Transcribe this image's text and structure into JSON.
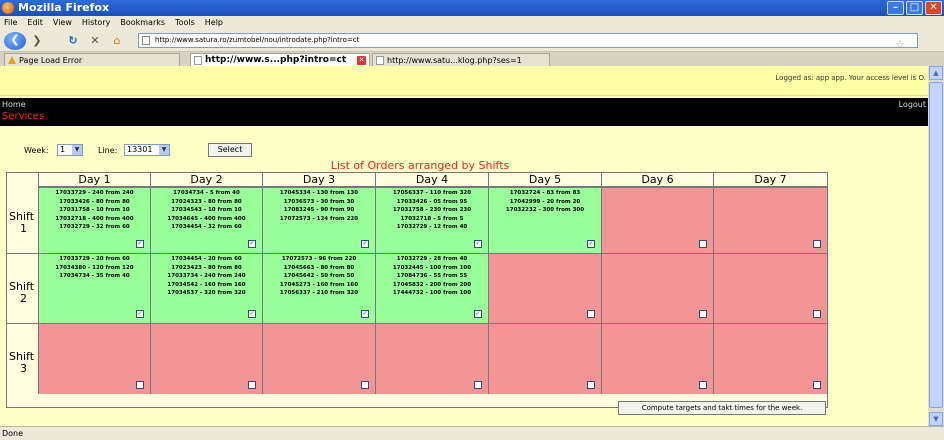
{
  "window": {
    "title": "Mozilla Firefox"
  },
  "menu": [
    "File",
    "Edit",
    "View",
    "History",
    "Bookmarks",
    "Tools",
    "Help"
  ],
  "url": "http://www.satura.ro/zumtobel/nou/introdate.php?intro=ct",
  "tabs": [
    {
      "label": "Page Load Error"
    },
    {
      "label": "http://www.s...php?intro=ct"
    },
    {
      "label": "http://www.satu...klog.php?ses=1"
    }
  ],
  "info": {
    "logged_as": "Logged as: app app. Your access level is O."
  },
  "nav": {
    "home": "Home",
    "services": "Services",
    "logout": "Logout"
  },
  "filters": {
    "week_label": "Week:",
    "week_value": "1",
    "line_label": "Line:",
    "line_value": "13301",
    "select_button": "Select"
  },
  "heading": "List of Orders arranged by Shifts",
  "days": [
    "Day 1",
    "Day 2",
    "Day 3",
    "Day 4",
    "Day 5",
    "Day 6",
    "Day 7"
  ],
  "shifts": [
    {
      "line1": "Shift",
      "line2": "1"
    },
    {
      "line1": "Shift",
      "line2": "2"
    },
    {
      "line1": "Shift",
      "line2": "3"
    }
  ],
  "shift_cells": {
    "s1": {
      "d1": [
        "17033729 - 240 from 240",
        "17033426 - 80 from 80",
        "17031758 - 10 from 10",
        "17032718 - 400 from 400",
        "17032729 - 32 from 60"
      ],
      "d2": [
        "17034734 - 5 from 40",
        "17024323 - 80 from 80",
        "17034543 - 10 from 10",
        "17034645 - 400 from 400",
        "17034454 - 32 from 60"
      ],
      "d3": [
        "17045334 - 130 from 130",
        "17036573 - 30 from 30",
        "17083245 - 90 from 90",
        "17072573 - 124 from 220"
      ],
      "d4": [
        "17056337 - 110 from 320",
        "17033426 - 05 from 95",
        "17031758 - 230 from 230",
        "17032718 - 5 from 5",
        "17032729 - 12 from 40"
      ],
      "d5": [
        "17032724 - 83 from 83",
        "17042999 - 20 from 20",
        "17032232 - 300 from 300"
      ]
    },
    "s2": {
      "d1": [
        "17033729 - 20 from 60",
        "17034380 - 120 from 120",
        "17034734 - 35 from 40"
      ],
      "d2": [
        "17034454 - 20 from 60",
        "17023423 - 80 from 80",
        "17033734 - 240 from 240",
        "17034542 - 160 from 160",
        "17034537 - 320 from 320"
      ],
      "d3": [
        "17072573 - 96 from 220",
        "17045663 - 80 from 80",
        "17045642 - 50 from 50",
        "17045273 - 160 from 160",
        "17056337 - 210 from 320"
      ],
      "d4": [
        "17032729 - 28 from 40",
        "17032445 - 100 from 100",
        "17084736 - 55 from 55",
        "17045832 - 200 from 200",
        "17444732 - 100 from 100"
      ]
    }
  },
  "compute_button": "Compute targets and takt times for the week.",
  "status": "Done"
}
